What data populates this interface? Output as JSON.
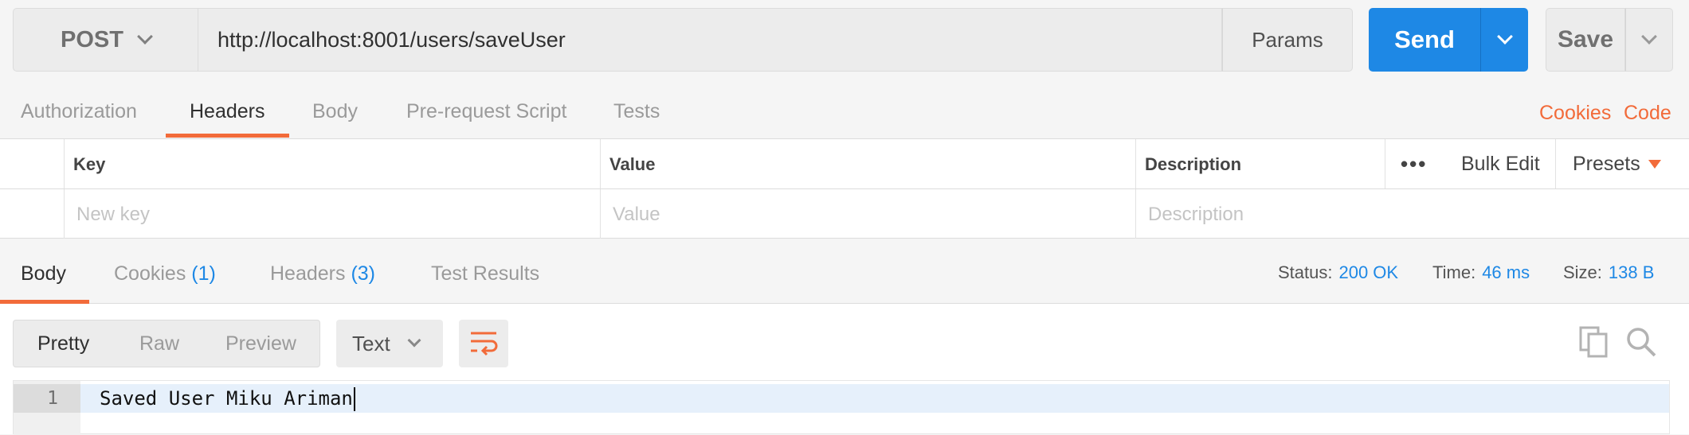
{
  "request": {
    "method": "POST",
    "url": "http://localhost:8001/users/saveUser",
    "params_label": "Params",
    "send_label": "Send",
    "save_label": "Save"
  },
  "request_tabs": {
    "authorization": "Authorization",
    "headers": "Headers",
    "body": "Body",
    "pre_request": "Pre-request Script",
    "tests": "Tests",
    "cookies": "Cookies",
    "code": "Code"
  },
  "headers_table": {
    "key_header": "Key",
    "value_header": "Value",
    "description_header": "Description",
    "more": "•••",
    "bulk_edit": "Bulk Edit",
    "presets": "Presets",
    "key_placeholder": "New key",
    "value_placeholder": "Value",
    "description_placeholder": "Description"
  },
  "response_tabs": {
    "body": "Body",
    "cookies": "Cookies",
    "cookies_count": "(1)",
    "headers": "Headers",
    "headers_count": "(3)",
    "test_results": "Test Results"
  },
  "response_status": {
    "status_label": "Status:",
    "status_value": "200 OK",
    "time_label": "Time:",
    "time_value": "46 ms",
    "size_label": "Size:",
    "size_value": "138 B"
  },
  "response_view": {
    "pretty": "Pretty",
    "raw": "Raw",
    "preview": "Preview",
    "format": "Text"
  },
  "response_body": {
    "line_number": "1",
    "line_text": "Saved User Miku Ariman"
  },
  "colors": {
    "accent": "#f26b3a",
    "primary": "#1e88e5"
  }
}
